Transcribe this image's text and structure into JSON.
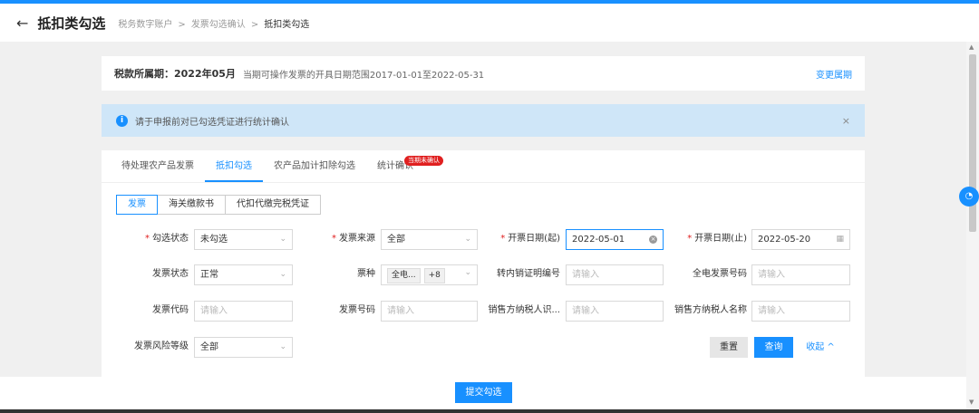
{
  "header": {
    "back_icon": "←",
    "title": "抵扣类勾选",
    "breadcrumbs": [
      "税务数字账户",
      "发票勾选确认",
      "抵扣类勾选"
    ],
    "sep": ">"
  },
  "period": {
    "label": "税款所属期：2022年05月",
    "desc": "当期可操作发票的开具日期范围2017-01-01至2022-05-31",
    "link": "变更属期"
  },
  "alert": {
    "icon": "i",
    "text": "请于申报前对已勾选凭证进行统计确认",
    "close": "×"
  },
  "tabs": [
    "待处理农产品发票",
    "抵扣勾选",
    "农产品加计扣除勾选",
    "统计确认"
  ],
  "tab_badge": "当期未确认",
  "subtabs": [
    "发票",
    "海关缴款书",
    "代扣代缴完税凭证"
  ],
  "form": {
    "gouxuan_status": {
      "label": "勾选状态",
      "value": "未勾选"
    },
    "fapiao_laiyuan": {
      "label": "发票来源",
      "value": "全部"
    },
    "kaipiao_start": {
      "label": "开票日期(起)",
      "value": "2022-05-01"
    },
    "kaipiao_end": {
      "label": "开票日期(止)",
      "value": "2022-05-20"
    },
    "fapiao_status": {
      "label": "发票状态",
      "value": "正常"
    },
    "piaozhong": {
      "label": "票种",
      "tag1": "全电...",
      "tag2": "+8"
    },
    "zhuannei": {
      "label": "转内销证明编号",
      "placeholder": "请输入"
    },
    "quandian_hao": {
      "label": "全电发票号码",
      "placeholder": "请输入"
    },
    "fapiao_daima": {
      "label": "发票代码",
      "placeholder": "请输入"
    },
    "fapiao_haoma": {
      "label": "发票号码",
      "placeholder": "请输入"
    },
    "xiaoshou_id": {
      "label": "销售方纳税人识...",
      "placeholder": "请输入"
    },
    "xiaoshou_name": {
      "label": "销售方纳税人名称",
      "placeholder": "请输入"
    },
    "fengxian": {
      "label": "发票风险等级",
      "value": "全部"
    }
  },
  "buttons": {
    "reset": "重置",
    "query": "查询",
    "collapse": "收起 ^",
    "submit": "提交勾选"
  },
  "colors": {
    "primary": "#1890ff",
    "required": "#e02020"
  }
}
